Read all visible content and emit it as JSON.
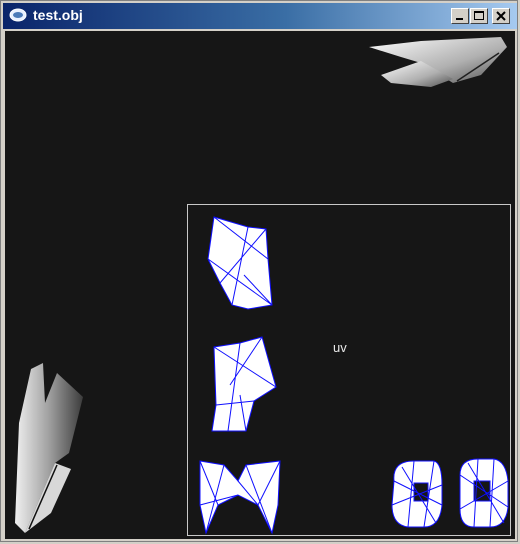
{
  "window": {
    "title": "test.obj"
  },
  "titlebar_buttons": {
    "minimize": "minimize",
    "maximize": "maximize",
    "close": "close"
  },
  "viewport": {
    "uv_label": "uv"
  },
  "colors": {
    "background": "#161616",
    "wireframe": "#0000ff",
    "uv_border": "#c8c8c8",
    "titlebar_start": "#0a246a",
    "titlebar_end": "#a6caf0"
  }
}
